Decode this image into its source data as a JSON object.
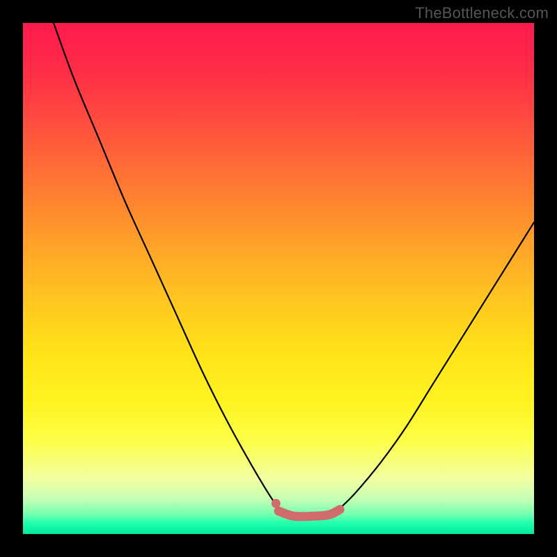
{
  "watermark": "TheBottleneck.com",
  "chart_data": {
    "type": "line",
    "title": "",
    "xlabel": "",
    "ylabel": "",
    "xlim": [
      0,
      100
    ],
    "ylim": [
      0,
      100
    ],
    "series": [
      {
        "name": "left-curve",
        "x": [
          6,
          10,
          15,
          20,
          25,
          30,
          35,
          40,
          45,
          48,
          50
        ],
        "y": [
          100,
          89,
          77,
          65,
          54,
          43,
          32,
          22,
          13,
          8,
          5
        ]
      },
      {
        "name": "right-curve",
        "x": [
          62,
          65,
          70,
          75,
          80,
          85,
          90,
          95,
          100
        ],
        "y": [
          5,
          8,
          14,
          21,
          29,
          37,
          45,
          53,
          61
        ]
      },
      {
        "name": "marker-band",
        "x": [
          50,
          53,
          57,
          60,
          62
        ],
        "y": [
          4.5,
          3.5,
          3.5,
          3.8,
          4.8
        ]
      }
    ],
    "marker_dot": {
      "x": 49.5,
      "y": 6
    },
    "colors": {
      "curve": "#000000",
      "marker": "#cf6b6a",
      "gradient_top": "#ff1a4d",
      "gradient_bottom": "#00e89a"
    }
  }
}
